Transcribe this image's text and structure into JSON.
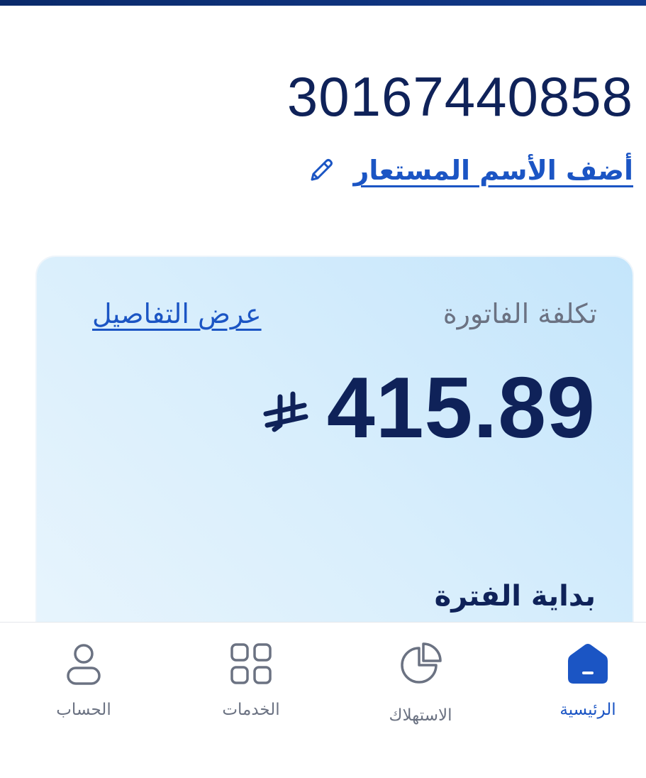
{
  "header": {
    "account_number": "30167440858",
    "alias_link": "أضف الأسم المستعار",
    "alias_icon": "pencil-icon"
  },
  "bill_card": {
    "title": "تكلفة الفاتورة",
    "details_link": "عرض التفاصيل",
    "amount": "415.89",
    "currency_icon": "saudi-riyal-icon",
    "period_label": "بداية الفترة"
  },
  "bottom_nav": {
    "items": [
      {
        "label": "الرئيسية",
        "icon": "home-icon",
        "active": true
      },
      {
        "label": "الاستهلاك",
        "icon": "pie-chart-icon",
        "active": false
      },
      {
        "label": "الخدمات",
        "icon": "grid-icon",
        "active": false
      },
      {
        "label": "الحساب",
        "icon": "user-icon",
        "active": false
      }
    ]
  },
  "colors": {
    "primary_dark": "#0f2259",
    "link_blue": "#1b55c4",
    "muted_gray": "#6b7282",
    "card_bg": "#d8eefc"
  }
}
